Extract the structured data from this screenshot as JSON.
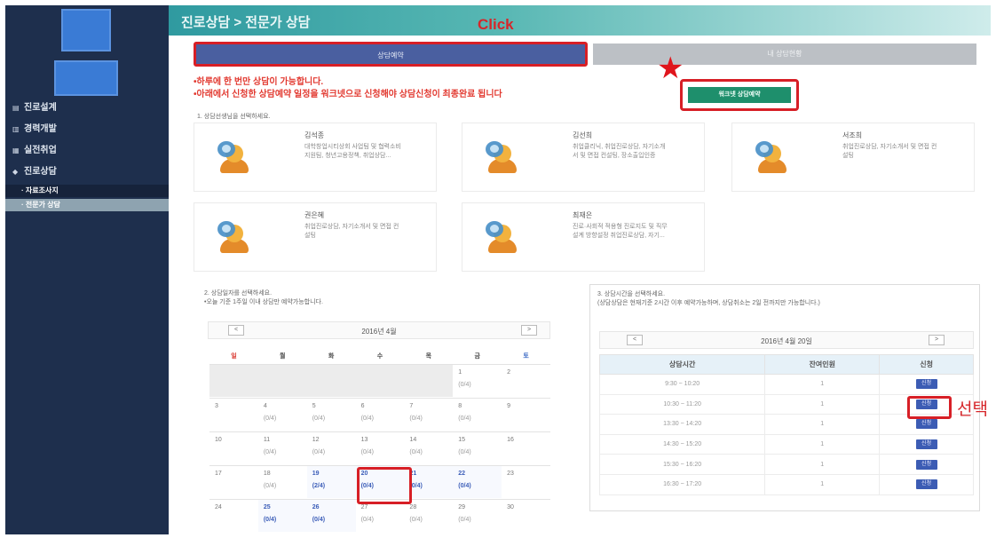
{
  "sidebar": {
    "items": [
      {
        "icon": "chart-icon",
        "glyph": "▤",
        "label": "진로설계"
      },
      {
        "icon": "book-icon",
        "glyph": "▥",
        "label": "경력개발"
      },
      {
        "icon": "briefcase-icon",
        "glyph": "▦",
        "label": "실전취업"
      },
      {
        "icon": "chat-icon",
        "glyph": "◆",
        "label": "진로상담"
      }
    ],
    "subitems": [
      "· 자료조사지",
      "· 전문가 상담"
    ]
  },
  "header": {
    "title": "진로상담 > 전문가 상담"
  },
  "annotations": {
    "click": "Click",
    "select": "선택",
    "star": "★"
  },
  "tabs": {
    "active": "상담예약",
    "inactive": "내 상담현황"
  },
  "notices": {
    "line1": "•하루에 한 번만 상담이 가능합니다.",
    "line2": "•아래에서 신청한 상담예약 일정을 워크넷으로 신청해야 상담신청이 최종완료 됩니다"
  },
  "apply_button": "워크넷 상담예약",
  "steps": {
    "counselor": "1. 상담선생님을 선택하세요.",
    "date": "2. 상담일자를 선택하세요.",
    "date_note": "•오늘 기준 1주일 이내 상담만 예약가능합니다.",
    "time": "3. 상담시간을 선택하세요.",
    "time_note": "(상담상담은 현재기준 2시간 이후 예약가능하며, 상담취소는 2일 전까지만 가능합니다.)"
  },
  "counselors": [
    {
      "name": "김석종",
      "desc": "대학창업시티상회 사업팀 및 협력소비지원팀, 청년고용정책, 취업상담..."
    },
    {
      "name": "김선희",
      "desc": "취업클리닉, 취업진로상담, 자기소개서 및 면접 컨설팅, 장소출입인증"
    },
    {
      "name": "서조희",
      "desc": "취업진로상담, 자기소개서 및 면접 컨설팅"
    },
    {
      "name": "권은혜",
      "desc": "취업진로상담, 자기소개서 및 면접 컨설팅"
    },
    {
      "name": "최재은",
      "desc": "진로·사회적 적용형 진로지도 및 직무설계 방향설정 취업진로상담, 자기..."
    }
  ],
  "calendar": {
    "title": "2016년 4월",
    "prev": "<",
    "next": ">",
    "days": [
      "일",
      "월",
      "화",
      "수",
      "목",
      "금",
      "토"
    ],
    "weeks": [
      [
        {
          "d": "",
          "c": "",
          "s": "empty"
        },
        {
          "d": "",
          "c": "",
          "s": "empty"
        },
        {
          "d": "",
          "c": "",
          "s": "empty"
        },
        {
          "d": "",
          "c": "",
          "s": "empty"
        },
        {
          "d": "",
          "c": "",
          "s": "empty"
        },
        {
          "d": "1",
          "c": "(0/4)",
          "s": ""
        },
        {
          "d": "2",
          "c": "",
          "s": ""
        }
      ],
      [
        {
          "d": "3",
          "c": "",
          "s": ""
        },
        {
          "d": "4",
          "c": "(0/4)",
          "s": ""
        },
        {
          "d": "5",
          "c": "(0/4)",
          "s": ""
        },
        {
          "d": "6",
          "c": "(0/4)",
          "s": ""
        },
        {
          "d": "7",
          "c": "(0/4)",
          "s": ""
        },
        {
          "d": "8",
          "c": "(0/4)",
          "s": ""
        },
        {
          "d": "9",
          "c": "",
          "s": ""
        }
      ],
      [
        {
          "d": "10",
          "c": "",
          "s": ""
        },
        {
          "d": "11",
          "c": "(0/4)",
          "s": ""
        },
        {
          "d": "12",
          "c": "(0/4)",
          "s": ""
        },
        {
          "d": "13",
          "c": "(0/4)",
          "s": ""
        },
        {
          "d": "14",
          "c": "(0/4)",
          "s": ""
        },
        {
          "d": "15",
          "c": "(0/4)",
          "s": ""
        },
        {
          "d": "16",
          "c": "",
          "s": ""
        }
      ],
      [
        {
          "d": "17",
          "c": "",
          "s": ""
        },
        {
          "d": "18",
          "c": "(0/4)",
          "s": ""
        },
        {
          "d": "19",
          "c": "(2/4)",
          "s": "avail"
        },
        {
          "d": "20",
          "c": "(0/4)",
          "s": "avail"
        },
        {
          "d": "21",
          "c": "(0/4)",
          "s": "avail"
        },
        {
          "d": "22",
          "c": "(0/4)",
          "s": "avail"
        },
        {
          "d": "23",
          "c": "",
          "s": ""
        }
      ],
      [
        {
          "d": "24",
          "c": "",
          "s": ""
        },
        {
          "d": "25",
          "c": "(0/4)",
          "s": "avail"
        },
        {
          "d": "26",
          "c": "(0/4)",
          "s": "avail"
        },
        {
          "d": "27",
          "c": "(0/4)",
          "s": ""
        },
        {
          "d": "28",
          "c": "(0/4)",
          "s": ""
        },
        {
          "d": "29",
          "c": "(0/4)",
          "s": ""
        },
        {
          "d": "30",
          "c": "",
          "s": ""
        }
      ]
    ]
  },
  "timetable": {
    "title": "2016년 4월 20일",
    "prev": "<",
    "next": ">",
    "headers": [
      "상담시간",
      "잔여인원",
      "신청"
    ],
    "rows": [
      {
        "time": "9:30 ~ 10:20",
        "remain": "1",
        "action": "신청"
      },
      {
        "time": "10:30 ~ 11:20",
        "remain": "1",
        "action": "신청"
      },
      {
        "time": "13:30 ~ 14:20",
        "remain": "1",
        "action": "신청"
      },
      {
        "time": "14:30 ~ 15:20",
        "remain": "1",
        "action": "신청"
      },
      {
        "time": "15:30 ~ 16:20",
        "remain": "1",
        "action": "신청"
      },
      {
        "time": "16:30 ~ 17:20",
        "remain": "1",
        "action": "신청"
      }
    ]
  }
}
